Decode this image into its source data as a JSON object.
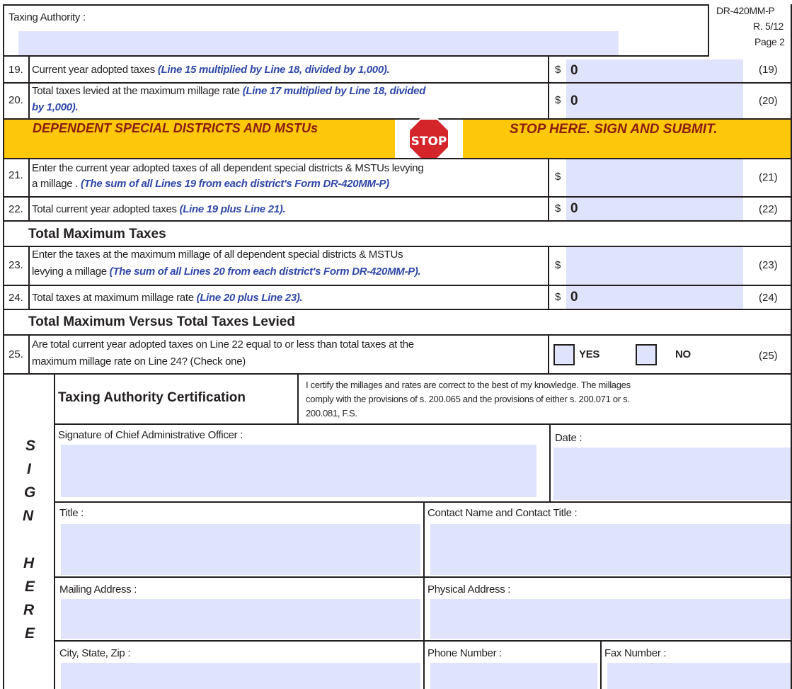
{
  "header": {
    "taxing_authority_label": "Taxing Authority :",
    "taxing_authority_value": "",
    "form_id": "DR-420MM-P",
    "revision": "R. 5/12",
    "page": "Page 2"
  },
  "lines": {
    "l19": {
      "num": "19.",
      "text": "Current year adopted taxes ",
      "note": "(Line 15 multiplied by Line 18, divided by 1,000).",
      "dollar": "$",
      "value": "0",
      "ref": "(19)"
    },
    "l20": {
      "num": "20.",
      "text": "Total taxes levied at the maximum millage rate ",
      "note1": "(Line 17 multiplied by Line 18, divided",
      "note2": "by 1,000).",
      "dollar": "$",
      "value": "0",
      "ref": "(20)"
    },
    "l21": {
      "num": "21.",
      "text1": "Enter the current year adopted taxes of all dependent special districts & MSTUs levying",
      "text2": "a millage . ",
      "note": "(The sum of all Lines 19 from each district's Form DR-420MM-P)",
      "dollar": "$",
      "value": "",
      "ref": "(21)"
    },
    "l22": {
      "num": "22.",
      "text": "Total current year adopted taxes ",
      "note": "(Line 19 plus Line 21).",
      "dollar": "$",
      "value": "0",
      "ref": "(22)"
    },
    "l23": {
      "num": "23.",
      "text1": "Enter the taxes at the maximum millage of all dependent special districts & MSTUs",
      "text2": "levying a millage ",
      "note": "(The sum of all Lines 20 from each district's Form DR-420MM-P).",
      "dollar": "$",
      "value": "",
      "ref": "(23)"
    },
    "l24": {
      "num": "24.",
      "text": "Total taxes at maximum millage rate ",
      "note": "(Line 20 plus Line 23).",
      "dollar": "$",
      "value": "0",
      "ref": "(24)"
    },
    "l25": {
      "num": "25.",
      "text1": "Are total current year adopted taxes on Line 22 equal to or less than total taxes at the",
      "text2": "maximum millage rate on Line 24? (Check one)",
      "yes": "YES",
      "no": "NO",
      "ref": "(25)"
    }
  },
  "banner": {
    "left": "DEPENDENT SPECIAL  DISTRICTS AND MSTUs",
    "stop": "STOP",
    "right": "STOP HERE. SIGN AND SUBMIT.",
    "bg_color": "#fdc80a",
    "text_color": "#8a1c10",
    "stop_color": "#d3252a"
  },
  "sections": {
    "total_max": "Total Maximum Taxes",
    "versus": "Total Maximum Versus Total Taxes Levied"
  },
  "certification": {
    "title": "Taxing Authority Certification",
    "text1": "I certify the millages and rates are correct to the best of my knowledge. The millages",
    "text2": "comply with the provisions of s. 200.065 and the provisions of either s. 200.071 or s.",
    "text3": "200.081, F.S.",
    "sign_here": [
      "S",
      "I",
      "G",
      "N",
      "H",
      "E",
      "R",
      "E"
    ],
    "fields": {
      "signature": "Signature of Chief Administrative Officer :",
      "date": "Date  :",
      "title": "Title :",
      "contact": "Contact Name and Contact Title :",
      "mailing": "Mailing Address :",
      "physical": "Physical Address :",
      "city": "City, State, Zip :",
      "phone": "Phone Number :",
      "fax": "Fax Number :"
    }
  }
}
